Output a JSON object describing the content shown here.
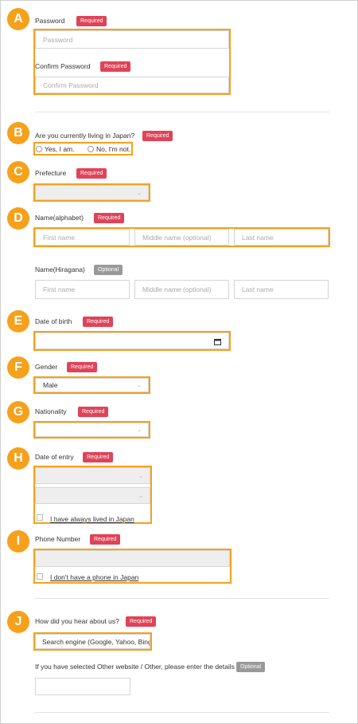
{
  "markers": [
    "A",
    "B",
    "C",
    "D",
    "E",
    "F",
    "G",
    "H",
    "I",
    "J"
  ],
  "badges": {
    "required": "Required",
    "optional": "Optional"
  },
  "password": {
    "label": "Password",
    "placeholder": "Password"
  },
  "confirm_password": {
    "label": "Confirm Password",
    "placeholder": "Confirm Password"
  },
  "living_in_japan": {
    "label": "Are you currently living in Japan?",
    "yes": "Yes, I am.",
    "no": "No, I'm not."
  },
  "prefecture": {
    "label": "Prefecture",
    "value": ""
  },
  "name_alphabet": {
    "label": "Name(alphabet)",
    "first": "First name",
    "middle": "Middle name (optional)",
    "last": "Last name"
  },
  "name_hiragana": {
    "label": "Name(Hiragana)",
    "first": "First name",
    "middle": "Middle name (optional)",
    "last": "Last name"
  },
  "date_of_birth": {
    "label": "Date of birth",
    "value": "",
    "icon": "calendar-icon"
  },
  "gender": {
    "label": "Gender",
    "value": "Male"
  },
  "nationality": {
    "label": "Nationality",
    "value": ""
  },
  "date_of_entry": {
    "label": "Date of entry",
    "checkbox": "I have always lived in Japan"
  },
  "phone": {
    "label": "Phone Number",
    "checkbox": "I don't have a phone in Japan"
  },
  "hear_about": {
    "label": "How did you hear about us?",
    "value": "Search engine (Google, Yahoo, Bing)"
  },
  "other_details": {
    "label": "If you have selected Other website / Other, please enter the details",
    "value": ""
  },
  "colors": {
    "accent": "#f5a11c",
    "required": "#e04358",
    "optional": "#999999"
  }
}
